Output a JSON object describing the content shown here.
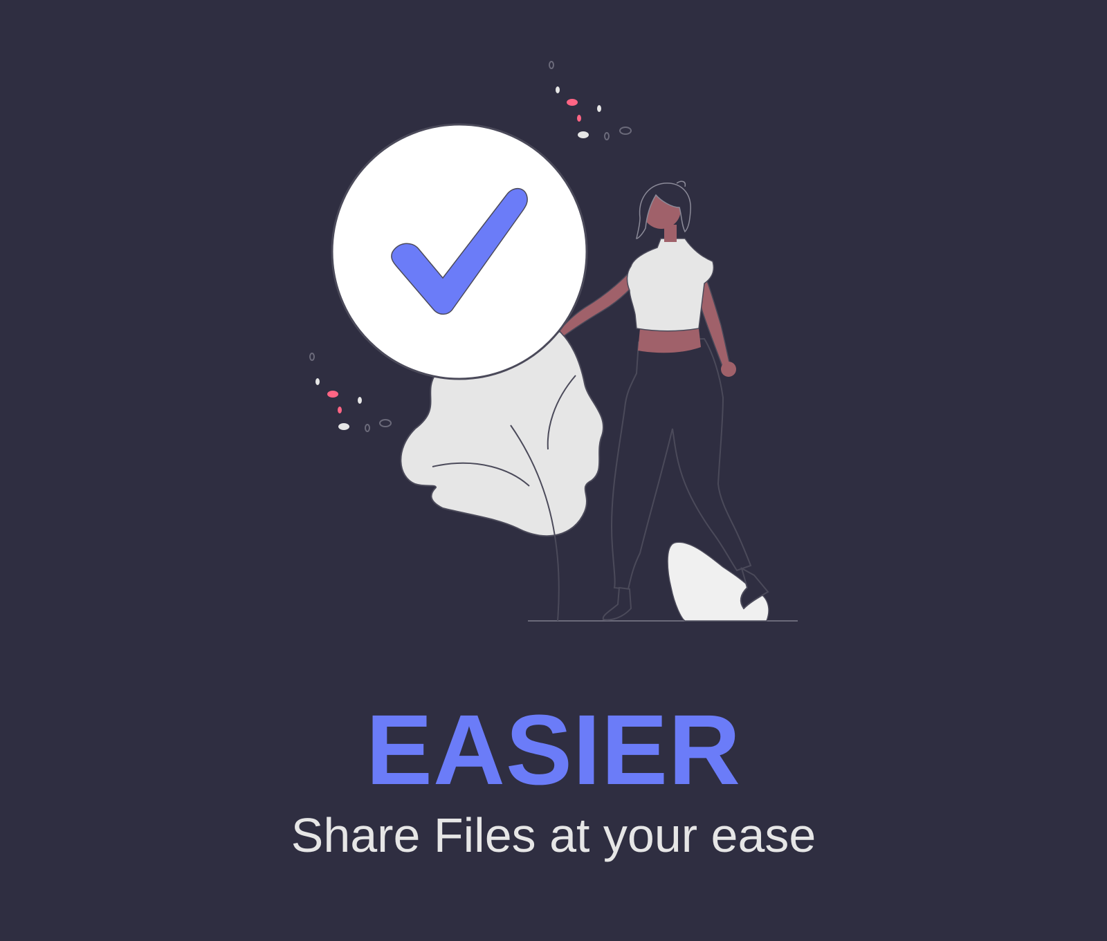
{
  "onboarding": {
    "headline": "EASIER",
    "subtitle": "Share Files at your ease"
  },
  "illustration": {
    "name": "woman-with-checkmark-illustration",
    "icon": "checkmark-icon"
  },
  "colors": {
    "background": "#2f2e41",
    "accent": "#6b7cf8",
    "text_light": "#e6e6e6",
    "skin": "#a0616a",
    "foliage": "#e6e6e6",
    "confetti_pink": "#ff6584"
  }
}
